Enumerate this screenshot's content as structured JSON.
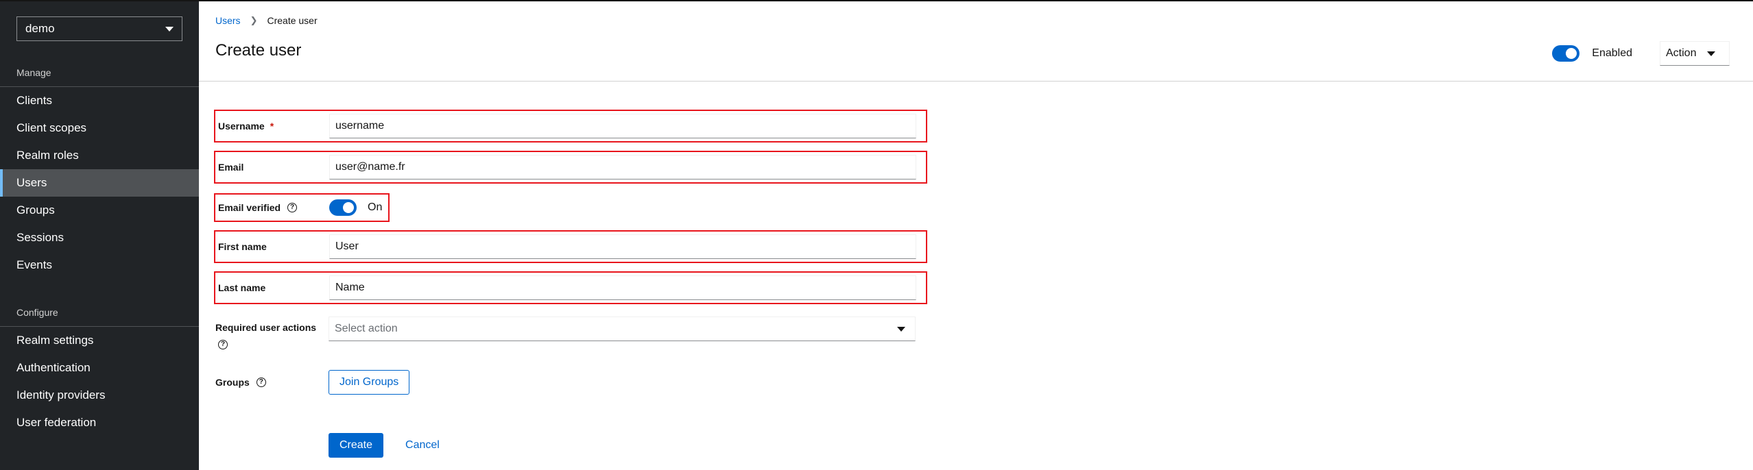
{
  "sidebar": {
    "realm": "demo",
    "manage_heading": "Manage",
    "manage_items": [
      "Clients",
      "Client scopes",
      "Realm roles",
      "Users",
      "Groups",
      "Sessions",
      "Events"
    ],
    "active_item": "Users",
    "configure_heading": "Configure",
    "configure_items": [
      "Realm settings",
      "Authentication",
      "Identity providers",
      "User federation"
    ]
  },
  "breadcrumb": {
    "parent": "Users",
    "current": "Create user"
  },
  "header": {
    "title": "Create user",
    "enabled_label": "Enabled",
    "action_label": "Action"
  },
  "form": {
    "username": {
      "label": "Username",
      "required_mark": "*",
      "value": "username"
    },
    "email": {
      "label": "Email",
      "value": "user@name.fr"
    },
    "email_verified": {
      "label": "Email verified",
      "state": "On"
    },
    "first_name": {
      "label": "First name",
      "value": "User"
    },
    "last_name": {
      "label": "Last name",
      "value": "Name"
    },
    "required_actions": {
      "label": "Required user actions",
      "placeholder": "Select action"
    },
    "groups": {
      "label": "Groups",
      "button": "Join Groups"
    },
    "create_button": "Create",
    "cancel_button": "Cancel"
  },
  "colors": {
    "primary": "#0066cc",
    "highlight_box": "#e8151c",
    "sidebar_bg": "#212427"
  },
  "icons": {
    "help": "question-circle-icon",
    "caret": "caret-down-icon",
    "breadcrumb_separator": "angle-right-icon"
  }
}
